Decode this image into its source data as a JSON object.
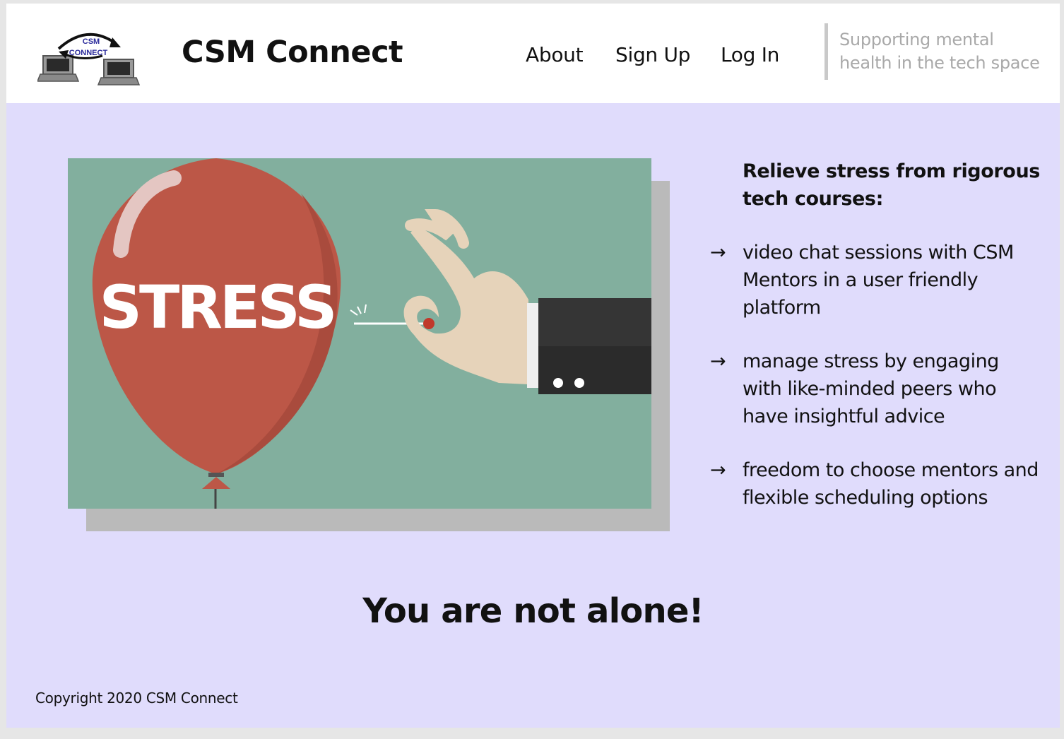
{
  "header": {
    "logo_text_top": "CSM",
    "logo_text_bottom": "CONNECT",
    "brand": "CSM Connect",
    "nav": {
      "about": "About",
      "signup": "Sign Up",
      "login": "Log In"
    },
    "tagline": "Supporting mental health in the tech space"
  },
  "hero": {
    "balloon_text": "STRESS",
    "icons": [
      "balloon-icon",
      "hand-with-pin-icon"
    ]
  },
  "benefits": {
    "heading": "Relieve stress from rigorous tech courses:",
    "arrow": "→",
    "items": [
      "video chat sessions with CSM Mentors in a user friendly platform",
      "manage stress by engaging with like-minded peers who have insightful advice",
      "freedom to choose mentors and flexible scheduling options"
    ]
  },
  "main": {
    "slogan": "You are not alone!"
  },
  "footer": {
    "copyright": "Copyright 2020 CSM Connect"
  },
  "colors": {
    "page_background": "#e0dcfc",
    "header_background": "#ffffff",
    "hero_background": "#82af9e",
    "balloon": "#bc5747",
    "tagline_text": "#a9a9a9"
  }
}
